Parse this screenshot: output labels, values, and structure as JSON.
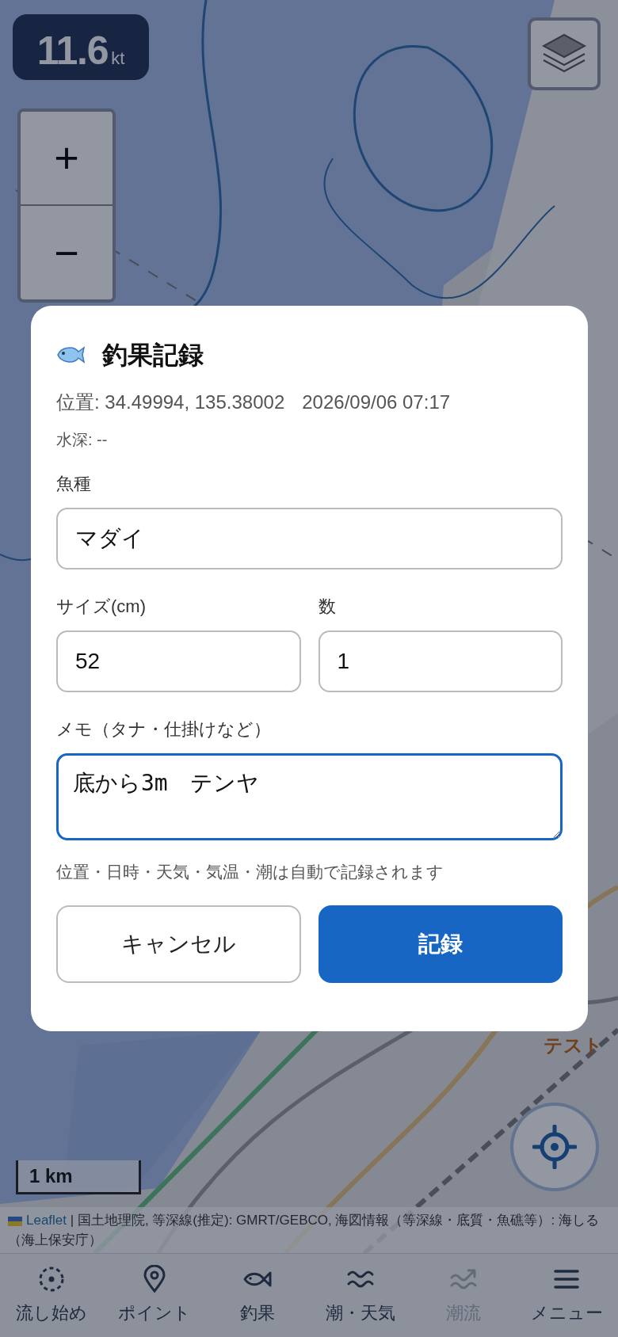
{
  "speed": {
    "value": "11.6",
    "unit": "kt"
  },
  "zoom_controls": [
    "+",
    "−"
  ],
  "point_label": "テスト",
  "scale_bar": "1 km",
  "attribution": {
    "link": "Leaflet",
    "text": " | 国土地理院, 等深線(推定): GMRT/GEBCO, 海図情報（等深線・底質・魚礁等）: 海しる（海上保安庁）"
  },
  "dialog": {
    "title": "釣果記録",
    "position": "位置: 34.49994, 135.38002",
    "datetime": "2026/09/06 07:17",
    "depth": "水深: --",
    "species": {
      "label": "魚種",
      "value": "マダイ"
    },
    "size": {
      "label": "サイズ(cm)",
      "value": "52"
    },
    "count": {
      "label": "数",
      "value": "1"
    },
    "memo": {
      "label": "メモ（タナ・仕掛けなど）",
      "value": "底から3m　テンヤ",
      "focused": true
    },
    "hint": "位置・日時・天気・気温・潮は自動で記録されます",
    "buttons": [
      {
        "label": "キャンセル",
        "kind": "secondary"
      },
      {
        "label": "記録",
        "kind": "primary"
      }
    ]
  },
  "nav": [
    {
      "label": "流し始め",
      "kind": "drift",
      "disabled": false
    },
    {
      "label": "ポイント",
      "kind": "pin",
      "disabled": false
    },
    {
      "label": "釣果",
      "kind": "fish",
      "disabled": false
    },
    {
      "label": "潮・天気",
      "kind": "tide",
      "disabled": false
    },
    {
      "label": "潮流",
      "kind": "current",
      "disabled": true
    },
    {
      "label": "メニュー",
      "kind": "menu",
      "disabled": false
    }
  ]
}
